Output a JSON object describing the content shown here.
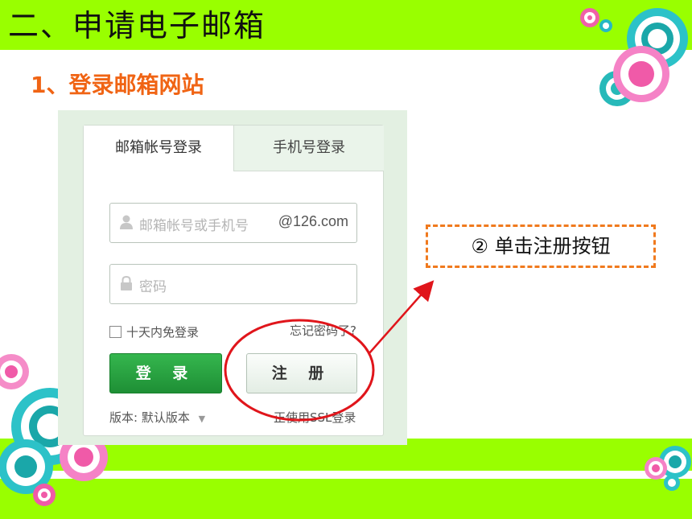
{
  "slide": {
    "title": "二、申请电子邮箱",
    "subtitle": "1、登录邮箱网站"
  },
  "login": {
    "tab_email": "邮箱帐号登录",
    "tab_phone": "手机号登录",
    "username_placeholder": "邮箱帐号或手机号",
    "domain": "@126.com",
    "password_placeholder": "密码",
    "remember_label": "十天内免登录",
    "forgot_link": "忘记密码了?",
    "login_button": "登 录",
    "register_button": "注 册",
    "version_label": "版本: 默认版本",
    "ssl_label": "正使用SSL登录"
  },
  "annotation": {
    "callout_text": "② 单击注册按钮"
  },
  "colors": {
    "green_band": "#99ff00",
    "accent_orange": "#f06414",
    "highlight_red": "#e0151b",
    "login_green": "#1e8f35"
  }
}
